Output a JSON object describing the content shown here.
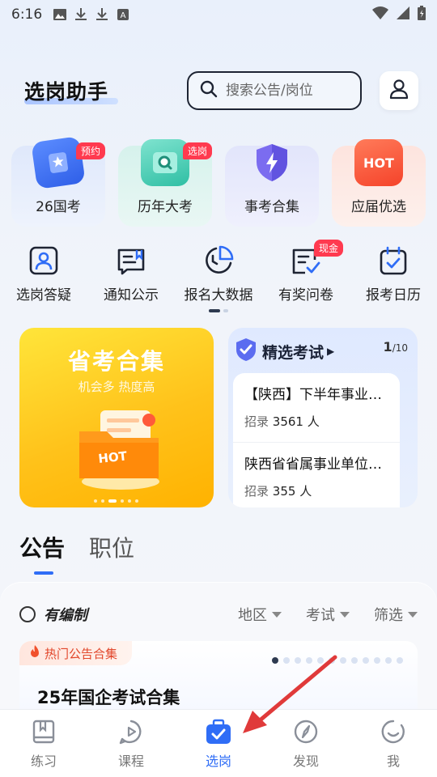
{
  "status_bar": {
    "time": "6:16"
  },
  "header": {
    "title": "选岗助手",
    "search_placeholder": "搜索公告/岗位"
  },
  "features": [
    {
      "label": "26国考",
      "badge": "预约",
      "icon": "star-book-icon"
    },
    {
      "label": "历年大考",
      "badge": "选岗",
      "icon": "search-box-icon"
    },
    {
      "label": "事考合集",
      "badge": "",
      "icon": "lightning-shield-icon"
    },
    {
      "label": "应届优选",
      "badge": "",
      "icon": "hot-box-icon"
    }
  ],
  "tools": [
    {
      "label": "选岗答疑",
      "badge": "",
      "icon": "person-card-icon"
    },
    {
      "label": "通知公示",
      "badge": "",
      "icon": "notice-icon"
    },
    {
      "label": "报名大数据",
      "badge": "",
      "icon": "pie-clock-icon"
    },
    {
      "label": "有奖问卷",
      "badge": "现金",
      "icon": "survey-check-icon"
    },
    {
      "label": "报考日历",
      "badge": "",
      "icon": "calendar-check-icon"
    }
  ],
  "promo": {
    "title": "省考合集",
    "subtitle": "机会多 热度高",
    "image_text": "HOT"
  },
  "exam_panel": {
    "title": "精选考试",
    "counter_current": "1",
    "counter_total": "/10",
    "items": [
      {
        "name": "【陕西】下半年事业单位招聘",
        "meta_label": "招录",
        "meta_value": "3561",
        "meta_unit": "人"
      },
      {
        "name": "陕西省省属事业单位招聘",
        "meta_label": "招录",
        "meta_value": "355",
        "meta_unit": "人"
      }
    ]
  },
  "tabs": [
    {
      "label": "公告",
      "active": true
    },
    {
      "label": "职位",
      "active": false
    }
  ],
  "filters": {
    "checkbox_label": "有编制",
    "options": [
      "地区",
      "考试",
      "筛选"
    ]
  },
  "hot_card": {
    "tag": "热门公告合集",
    "title": "25年国企考试合集"
  },
  "bottom_nav": [
    {
      "label": "练习",
      "icon": "book-icon",
      "active": false
    },
    {
      "label": "课程",
      "icon": "play-icon",
      "active": false
    },
    {
      "label": "选岗",
      "icon": "briefcase-check-icon",
      "active": true
    },
    {
      "label": "发现",
      "icon": "compass-icon",
      "active": false
    },
    {
      "label": "我",
      "icon": "smile-icon",
      "active": false
    }
  ],
  "colors": {
    "accent": "#2f6df6",
    "badge": "#ff3a4f",
    "promo": "#ffc21a",
    "annotation_arrow": "#e03a3a"
  }
}
